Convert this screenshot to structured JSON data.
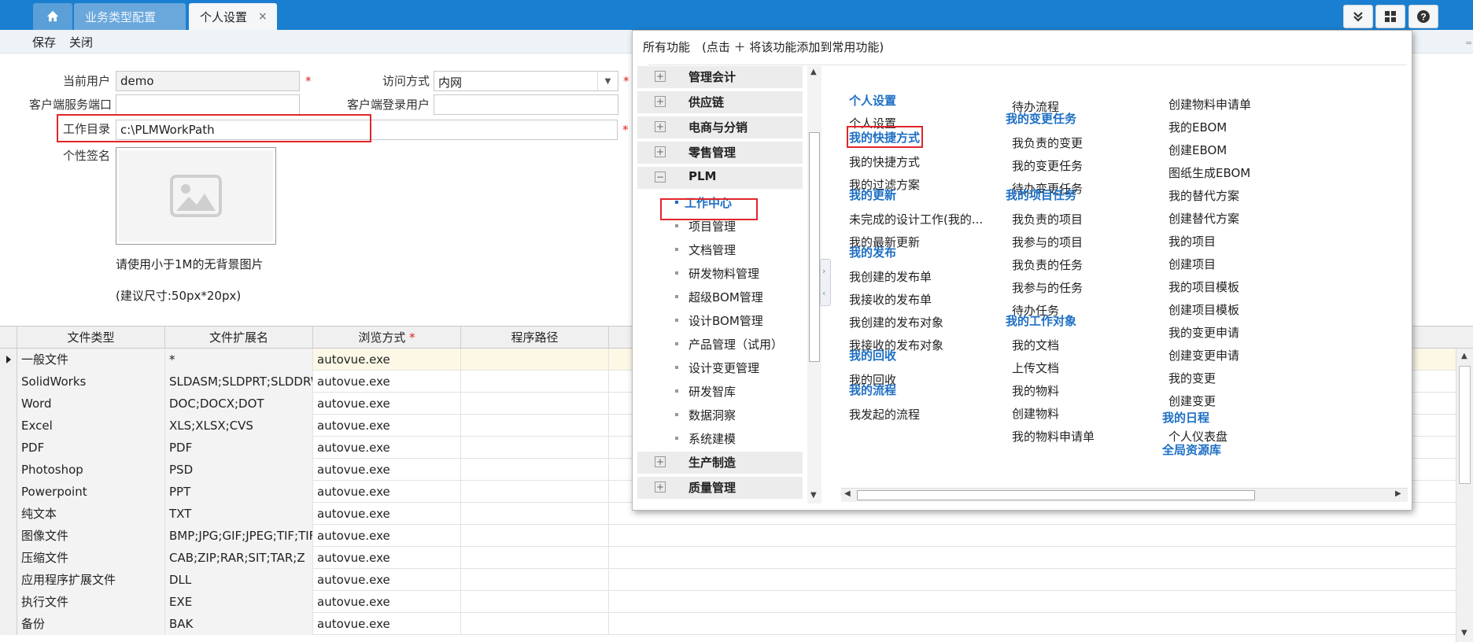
{
  "tabs": {
    "business": "业务类型配置",
    "personal": "个人设置",
    "close": "×"
  },
  "toolbar": {
    "save": "保存",
    "close": "关闭"
  },
  "form": {
    "current_user_label": "当前用户",
    "current_user_value": "demo",
    "access_label": "访问方式",
    "access_value": "内网",
    "client_port_label": "客户端服务端口",
    "client_port_value": "",
    "client_login_label": "客户端登录用户",
    "client_login_value": "",
    "workdir_label": "工作目录",
    "workdir_value": "c:\\PLMWorkPath",
    "signature_label": "个性签名",
    "hint1": "请使用小于1M的无背景图片",
    "hint2": "(建议尺寸:50px*20px)",
    "required": "*"
  },
  "grid": {
    "columns": [
      "文件类型",
      "文件扩展名",
      "浏览方式",
      "程序路径"
    ],
    "rows": [
      [
        "一般文件",
        "*",
        "autovue.exe",
        ""
      ],
      [
        "SolidWorks",
        "SLDASM;SLDPRT;SLDDRW",
        "autovue.exe",
        ""
      ],
      [
        "Word",
        "DOC;DOCX;DOT",
        "autovue.exe",
        ""
      ],
      [
        "Excel",
        "XLS;XLSX;CVS",
        "autovue.exe",
        ""
      ],
      [
        "PDF",
        "PDF",
        "autovue.exe",
        ""
      ],
      [
        "Photoshop",
        "PSD",
        "autovue.exe",
        ""
      ],
      [
        "Powerpoint",
        "PPT",
        "autovue.exe",
        ""
      ],
      [
        "纯文本",
        "TXT",
        "autovue.exe",
        ""
      ],
      [
        "图像文件",
        "BMP;JPG;GIF;JPEG;TIF;TIFF",
        "autovue.exe",
        ""
      ],
      [
        "压缩文件",
        "CAB;ZIP;RAR;SIT;TAR;Z",
        "autovue.exe",
        ""
      ],
      [
        "应用程序扩展文件",
        "DLL",
        "autovue.exe",
        ""
      ],
      [
        "执行文件",
        "EXE",
        "autovue.exe",
        ""
      ],
      [
        "备份",
        "BAK",
        "autovue.exe",
        ""
      ]
    ]
  },
  "popup": {
    "title": "所有功能　(点击 ＋ 将该功能添加到常用功能)",
    "left_menu": [
      {
        "label": "管理会计",
        "type": "group",
        "expanded": false
      },
      {
        "label": "供应链",
        "type": "group",
        "expanded": false
      },
      {
        "label": "电商与分销",
        "type": "group",
        "expanded": false
      },
      {
        "label": "零售管理",
        "type": "group",
        "expanded": false
      },
      {
        "label": "PLM",
        "type": "group",
        "expanded": true
      },
      {
        "label": "工作中心",
        "type": "sub",
        "active": true
      },
      {
        "label": "项目管理",
        "type": "sub"
      },
      {
        "label": "文档管理",
        "type": "sub"
      },
      {
        "label": "研发物料管理",
        "type": "sub"
      },
      {
        "label": "超级BOM管理",
        "type": "sub"
      },
      {
        "label": "设计BOM管理",
        "type": "sub"
      },
      {
        "label": "产品管理（试用）",
        "type": "sub"
      },
      {
        "label": "设计变更管理",
        "type": "sub"
      },
      {
        "label": "研发智库",
        "type": "sub"
      },
      {
        "label": "数据洞察",
        "type": "sub"
      },
      {
        "label": "系统建模",
        "type": "sub"
      },
      {
        "label": "生产制造",
        "type": "group",
        "expanded": false
      },
      {
        "label": "质量管理",
        "type": "group",
        "expanded": false
      }
    ],
    "col1": [
      {
        "t": "h",
        "label": "个人设置"
      },
      {
        "t": "l",
        "label": "个人设置"
      },
      {
        "t": "h",
        "label": "我的快捷方式"
      },
      {
        "t": "l",
        "label": "我的快捷方式"
      },
      {
        "t": "l",
        "label": "我的过滤方案"
      },
      {
        "t": "h",
        "label": "我的更新"
      },
      {
        "t": "l",
        "label": "未完成的设计工作(我的..."
      },
      {
        "t": "l",
        "label": "我的最新更新"
      },
      {
        "t": "h",
        "label": "我的发布"
      },
      {
        "t": "l",
        "label": "我创建的发布单"
      },
      {
        "t": "l",
        "label": "我接收的发布单"
      },
      {
        "t": "l",
        "label": "我创建的发布对象"
      },
      {
        "t": "l",
        "label": "我接收的发布对象"
      },
      {
        "t": "h",
        "label": "我的回收"
      },
      {
        "t": "l",
        "label": "我的回收"
      },
      {
        "t": "h",
        "label": "我的流程"
      },
      {
        "t": "l",
        "label": "我发起的流程"
      }
    ],
    "col2": [
      {
        "t": "l",
        "label": "待办流程"
      },
      {
        "t": "h",
        "label": "我的变更任务"
      },
      {
        "t": "l",
        "label": "我负责的变更"
      },
      {
        "t": "l",
        "label": "我的变更任务"
      },
      {
        "t": "l",
        "label": "待办变更任务"
      },
      {
        "t": "h",
        "label": "我的项目任务"
      },
      {
        "t": "l",
        "label": "我负责的项目"
      },
      {
        "t": "l",
        "label": "我参与的项目"
      },
      {
        "t": "l",
        "label": "我负责的任务"
      },
      {
        "t": "l",
        "label": "我参与的任务"
      },
      {
        "t": "l",
        "label": "待办任务"
      },
      {
        "t": "h",
        "label": "我的工作对象"
      },
      {
        "t": "l",
        "label": "我的文档"
      },
      {
        "t": "l",
        "label": "上传文档"
      },
      {
        "t": "l",
        "label": "我的物料"
      },
      {
        "t": "l",
        "label": "创建物料"
      },
      {
        "t": "l",
        "label": "我的物料申请单"
      }
    ],
    "col3": [
      {
        "t": "l",
        "label": "创建物料申请单"
      },
      {
        "t": "l",
        "label": "我的EBOM"
      },
      {
        "t": "l",
        "label": "创建EBOM"
      },
      {
        "t": "l",
        "label": "图纸生成EBOM"
      },
      {
        "t": "l",
        "label": "我的替代方案"
      },
      {
        "t": "l",
        "label": "创建替代方案"
      },
      {
        "t": "l",
        "label": "我的项目"
      },
      {
        "t": "l",
        "label": "创建项目"
      },
      {
        "t": "l",
        "label": "我的项目模板"
      },
      {
        "t": "l",
        "label": "创建项目模板"
      },
      {
        "t": "l",
        "label": "我的变更申请"
      },
      {
        "t": "l",
        "label": "创建变更申请"
      },
      {
        "t": "l",
        "label": "我的变更"
      },
      {
        "t": "l",
        "label": "创建变更"
      },
      {
        "t": "h",
        "label": "我的日程"
      },
      {
        "t": "l",
        "label": "个人仪表盘"
      },
      {
        "t": "h",
        "label": "全局资源库"
      }
    ]
  },
  "colors": {
    "accent": "#1a7fd0",
    "link_head": "#1d6fc4",
    "highlight_box": "#e0262b"
  }
}
